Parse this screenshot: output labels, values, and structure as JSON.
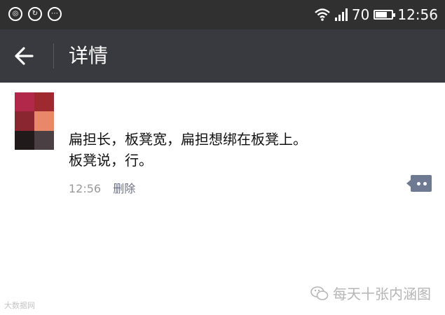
{
  "status_bar": {
    "battery_level": "70",
    "battery_fraction": 0.7,
    "time": "12:56",
    "left_icons": [
      "weibo-icon",
      "refresh-icon",
      "more-icon"
    ]
  },
  "header": {
    "title": "详情"
  },
  "post": {
    "text_line1": "扁担长，板凳宽，扁担想绑在板凳上。",
    "text_line2": "板凳说，行。",
    "time": "12:56",
    "delete_label": "删除"
  },
  "watermarks": {
    "right": "每天十张内涵图",
    "left": "大数据网"
  },
  "colors": {
    "status_bar": "#303030",
    "title_bar": "#393a3f",
    "link": "#6a6f82",
    "comment_button": "#6d7a91"
  }
}
